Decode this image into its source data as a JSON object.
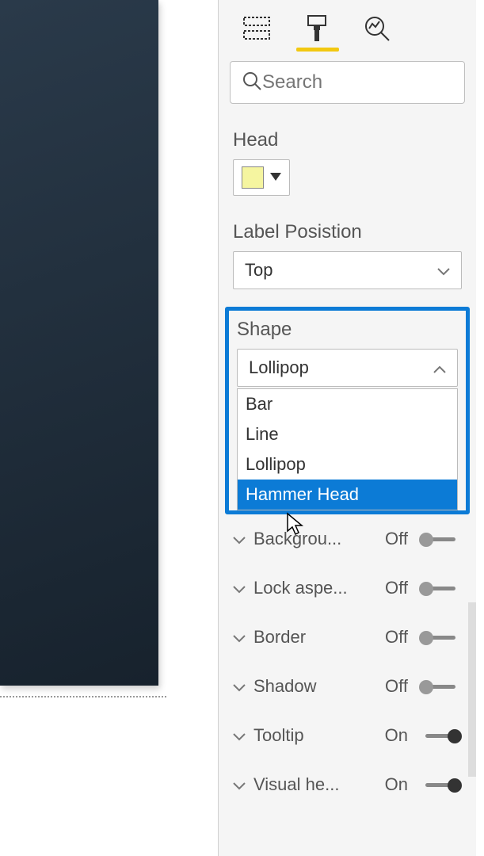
{
  "search": {
    "placeholder": "Search"
  },
  "props": {
    "head": {
      "label": "Head",
      "color": "#f5f5a0"
    },
    "labelPosition": {
      "label": "Label Posistion",
      "value": "Top"
    },
    "shape": {
      "label": "Shape",
      "value": "Lollipop",
      "options": [
        "Bar",
        "Line",
        "Lollipop",
        "Hammer Head"
      ],
      "hoveredIndex": 3
    }
  },
  "toggles": [
    {
      "label": "Backgrou...",
      "state": "Off",
      "on": false
    },
    {
      "label": "Lock aspe...",
      "state": "Off",
      "on": false
    },
    {
      "label": "Border",
      "state": "Off",
      "on": false
    },
    {
      "label": "Shadow",
      "state": "Off",
      "on": false
    },
    {
      "label": "Tooltip",
      "state": "On",
      "on": true
    },
    {
      "label": "Visual he...",
      "state": "On",
      "on": true
    }
  ],
  "colors": {
    "highlight": "#0c7bd6",
    "accent": "#f2c811"
  }
}
